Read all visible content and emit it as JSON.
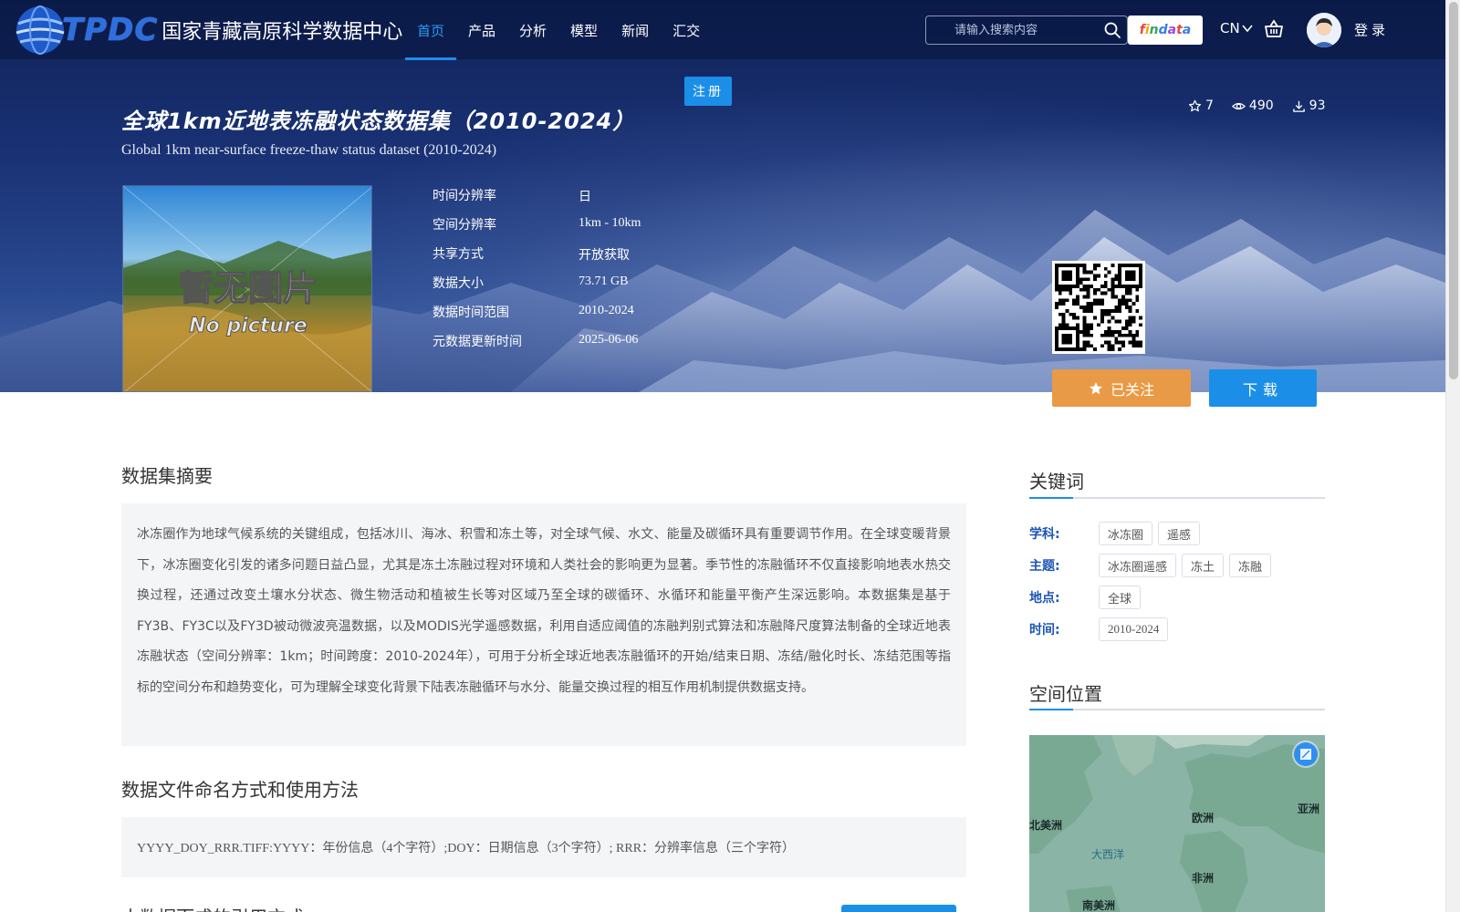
{
  "header": {
    "logo_tpdc": "TPDC",
    "logo_name": "国家青藏高原科学数据中心",
    "nav": [
      {
        "label": "首页"
      },
      {
        "label": "产品"
      },
      {
        "label": "分析"
      },
      {
        "label": "模型"
      },
      {
        "label": "新闻"
      },
      {
        "label": "汇交"
      }
    ],
    "active_nav": "首页",
    "search_placeholder": "请输入搜索内容",
    "findata_label": "findata",
    "language": "CN",
    "login_label": "登录",
    "register_label": "注册"
  },
  "dataset": {
    "title_cn": "全球1km近地表冻融状态数据集（2010-2024）",
    "title_en": "Global 1km near-surface freeze-thaw status dataset (2010-2024)",
    "stats": {
      "favorites": "7",
      "views": "490",
      "downloads": "93"
    },
    "thumbnail": {
      "text_cn": "暂无图片",
      "text_en": "No picture"
    },
    "meta": [
      {
        "label": "时间分辨率",
        "value": "日"
      },
      {
        "label": "空间分辨率",
        "value": "1km - 10km"
      },
      {
        "label": "共享方式",
        "value": "开放获取"
      },
      {
        "label": "数据大小",
        "value": "73.71 GB"
      },
      {
        "label": "数据时间范围",
        "value": "2010-2024"
      },
      {
        "label": "元数据更新时间",
        "value": "2025-06-06"
      }
    ],
    "follow_label": "已关注",
    "download_label": "下载"
  },
  "abstract": {
    "heading": "数据集摘要",
    "text": "冰冻圈作为地球气候系统的关键组成，包括冰川、海冰、积雪和冻土等，对全球气候、水文、能量及碳循环具有重要调节作用。在全球变暖背景下，冰冻圈变化引发的诸多问题日益凸显，尤其是冻土冻融过程对环境和人类社会的影响更为显著。季节性的冻融循环不仅直接影响地表水热交换过程，还通过改变土壤水分状态、微生物活动和植被生长等对区域乃至全球的碳循环、水循环和能量平衡产生深远影响。本数据集是基于FY3B、FY3C以及FY3D被动微波亮温数据，以及MODIS光学遥感数据，利用自适应阈值的冻融判别式算法和冻融降尺度算法制备的全球近地表冻融状态（空间分辨率：1km；时间跨度：2010-2024年），可用于分析全球近地表冻融循环的开始/结束日期、冻结/融化时长、冻结范围等指标的空间分布和趋势变化，可为理解全球变化背景下陆表冻融循环与水分、能量交换过程的相互作用机制提供数据支持。"
  },
  "naming": {
    "heading": "数据文件命名方式和使用方法",
    "text": "YYYY_DOY_RRR.TIFF:YYYY：年份信息（4个字符）;DOY：日期信息（3个字符）; RRR：分辨率信息（三个字符）"
  },
  "next_section": {
    "heading": "本数据而成的引用方式"
  },
  "keywords": {
    "heading": "关键词",
    "rows": [
      {
        "label": "学科:",
        "tags": [
          "冰冻圈",
          "遥感"
        ]
      },
      {
        "label": "主题:",
        "tags": [
          "冰冻圈遥感",
          "冻土",
          "冻融"
        ]
      },
      {
        "label": "地点:",
        "tags": [
          "全球"
        ]
      },
      {
        "label": "时间:",
        "tags": [
          "2010-2024"
        ]
      }
    ]
  },
  "location": {
    "heading": "空间位置",
    "map_labels": {
      "north_america": "北美洲",
      "europe": "欧洲",
      "asia": "亚洲",
      "atlantic": "大西洋",
      "africa": "非洲",
      "south_america": "南美洲"
    }
  },
  "colors": {
    "accent_blue": "#1b8fe8",
    "follow_orange": "#e99a46",
    "keyword_label": "#1c55b4"
  }
}
